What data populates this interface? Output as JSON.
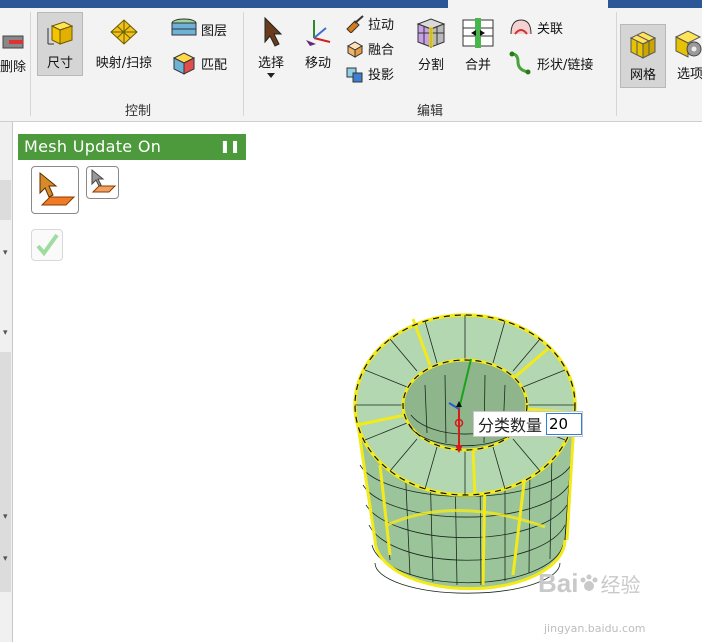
{
  "ribbon": {
    "left_partial_label": "删除",
    "buttons": {
      "size": "尺寸",
      "map_sweep": "映射/扫掠",
      "layer": "图层",
      "match": "匹配",
      "select": "选择",
      "move": "移动",
      "pull": "拉动",
      "fuse": "融合",
      "project": "投影",
      "split": "分割",
      "merge": "合并",
      "associate": "关联",
      "shape_link": "形状/链接",
      "mesh": "网格",
      "options": "选项"
    },
    "groups": {
      "control": "控制",
      "edit": "编辑"
    }
  },
  "panel": {
    "title": "Mesh Update On",
    "pause_symbol": "❚❚"
  },
  "count_input": {
    "label": "分类数量",
    "value": "20"
  },
  "watermark": {
    "logo": "Bai",
    "logo2": "经验",
    "url": "jingyan.baidu.com"
  },
  "colors": {
    "panel_green": "#4c9a3c",
    "mesh_yellow": "#f3ea1b",
    "mesh_fill": "#b3d7b0",
    "input_border": "#2f7fd9"
  }
}
